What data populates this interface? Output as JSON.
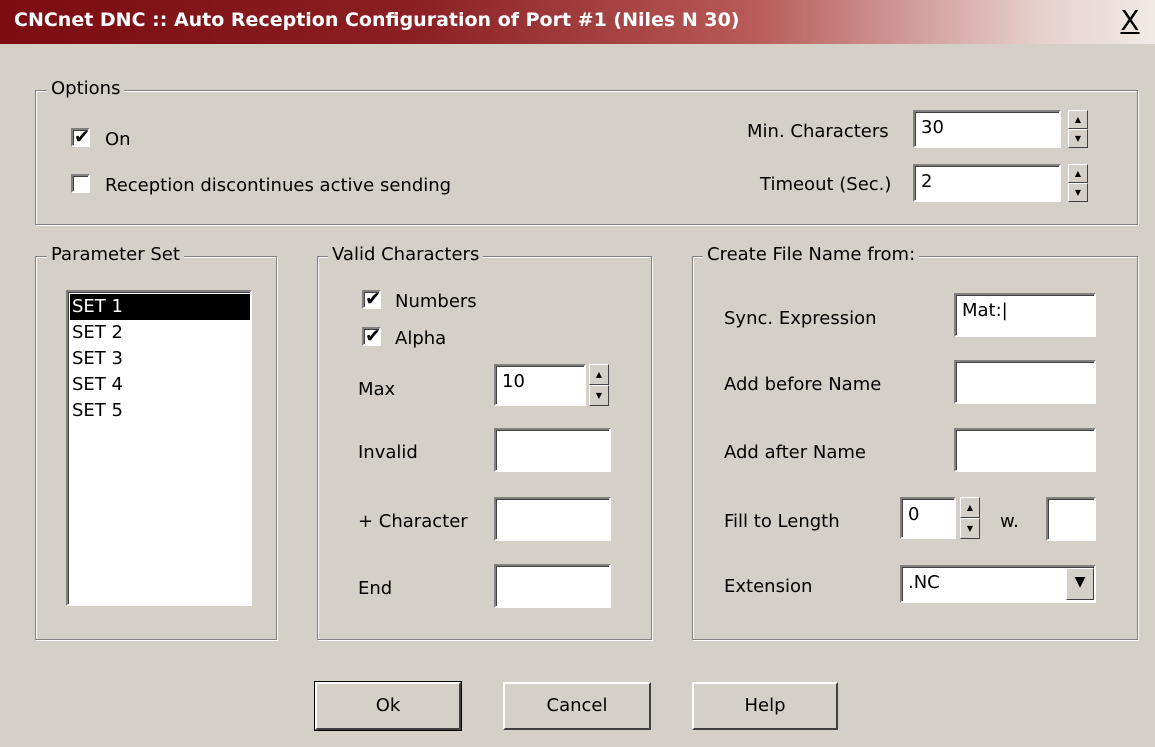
{
  "window": {
    "title": "CNCnet DNC :: Auto Reception Configuration of Port #1 (Niles N 30)",
    "close_glyph": "X"
  },
  "options": {
    "legend": "Options",
    "on_label": "On",
    "on_checked": true,
    "discontinue_label": "Reception discontinues active sending",
    "discontinue_checked": false,
    "min_chars_label": "Min. Characters",
    "min_chars_value": "30",
    "timeout_label": "Timeout (Sec.)",
    "timeout_value": "2"
  },
  "parameter_set": {
    "legend": "Parameter Set",
    "items": [
      "SET 1",
      "SET 2",
      "SET 3",
      "SET 4",
      "SET 5"
    ],
    "selected": "SET 1"
  },
  "valid_characters": {
    "legend": "Valid Characters",
    "numbers_label": "Numbers",
    "numbers_checked": true,
    "alpha_label": "Alpha",
    "alpha_checked": true,
    "max_label": "Max",
    "max_value": "10",
    "invalid_label": "Invalid",
    "invalid_value": "",
    "plus_char_label": "+ Character",
    "plus_char_value": "",
    "end_label": "End",
    "end_value": ""
  },
  "file_name": {
    "legend": "Create File Name from:",
    "sync_label": "Sync. Expression",
    "sync_value": "Mat:|",
    "before_label": "Add before Name",
    "before_value": "",
    "after_label": "Add after Name",
    "after_value": "",
    "fill_label": "Fill to Length",
    "fill_value": "0",
    "with_label": "w.",
    "with_value": "",
    "extension_label": "Extension",
    "extension_value": ".NC"
  },
  "buttons": {
    "ok": "Ok",
    "cancel": "Cancel",
    "help": "Help"
  },
  "icons": {
    "check": "✔",
    "spin_up": "▲",
    "spin_down": "▼",
    "combo_down": "▼"
  }
}
